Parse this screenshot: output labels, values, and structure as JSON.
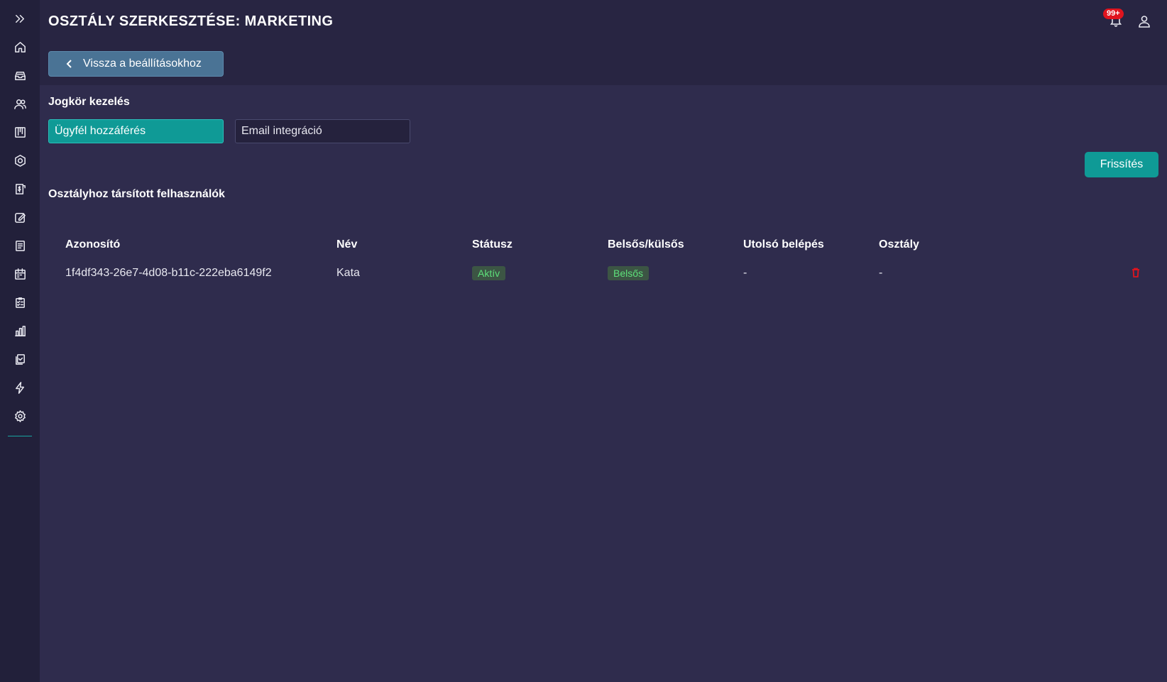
{
  "header": {
    "title": "OSZTÁLY SZERKESZTÉSE: MARKETING",
    "back_label": "Vissza a beállításokhoz",
    "notification_badge": "99+"
  },
  "sidebar": {
    "items": [
      {
        "icon": "expand-icon"
      },
      {
        "icon": "home-icon"
      },
      {
        "icon": "inbox-icon"
      },
      {
        "icon": "users-icon"
      },
      {
        "icon": "kanban-icon"
      },
      {
        "icon": "hexagon-settings-icon"
      },
      {
        "icon": "invoice-icon"
      },
      {
        "icon": "edit-note-icon"
      },
      {
        "icon": "document-icon"
      },
      {
        "icon": "calendar-icon"
      },
      {
        "icon": "checklist-icon"
      },
      {
        "icon": "bar-chart-icon"
      },
      {
        "icon": "copy-check-icon"
      },
      {
        "icon": "lightning-icon"
      },
      {
        "icon": "gear-icon"
      }
    ]
  },
  "permissions": {
    "title": "Jogkör kezelés",
    "items": [
      {
        "label": "Ügyfél hozzáférés",
        "active": true
      },
      {
        "label": "Email integráció",
        "active": false
      }
    ],
    "refresh_label": "Frissítés"
  },
  "users": {
    "title": "Osztályhoz társított felhasználók",
    "columns": [
      "Azonosító",
      "Név",
      "Státusz",
      "Belsős/külsős",
      "Utolsó belépés",
      "Osztály"
    ],
    "rows": [
      {
        "id": "1f4df343-26e7-4d08-b11c-222eba6149f2",
        "name": "Kata",
        "status": "Aktív",
        "type": "Belsős",
        "last_login": "-",
        "department": "-"
      }
    ]
  },
  "colors": {
    "accent": "#0f9a96",
    "back_button": "#4a7395",
    "background": "#2f2c4d",
    "sidebar": "#22203a",
    "badge": "#e0141e",
    "status_pill_text": "#5ee07a"
  }
}
